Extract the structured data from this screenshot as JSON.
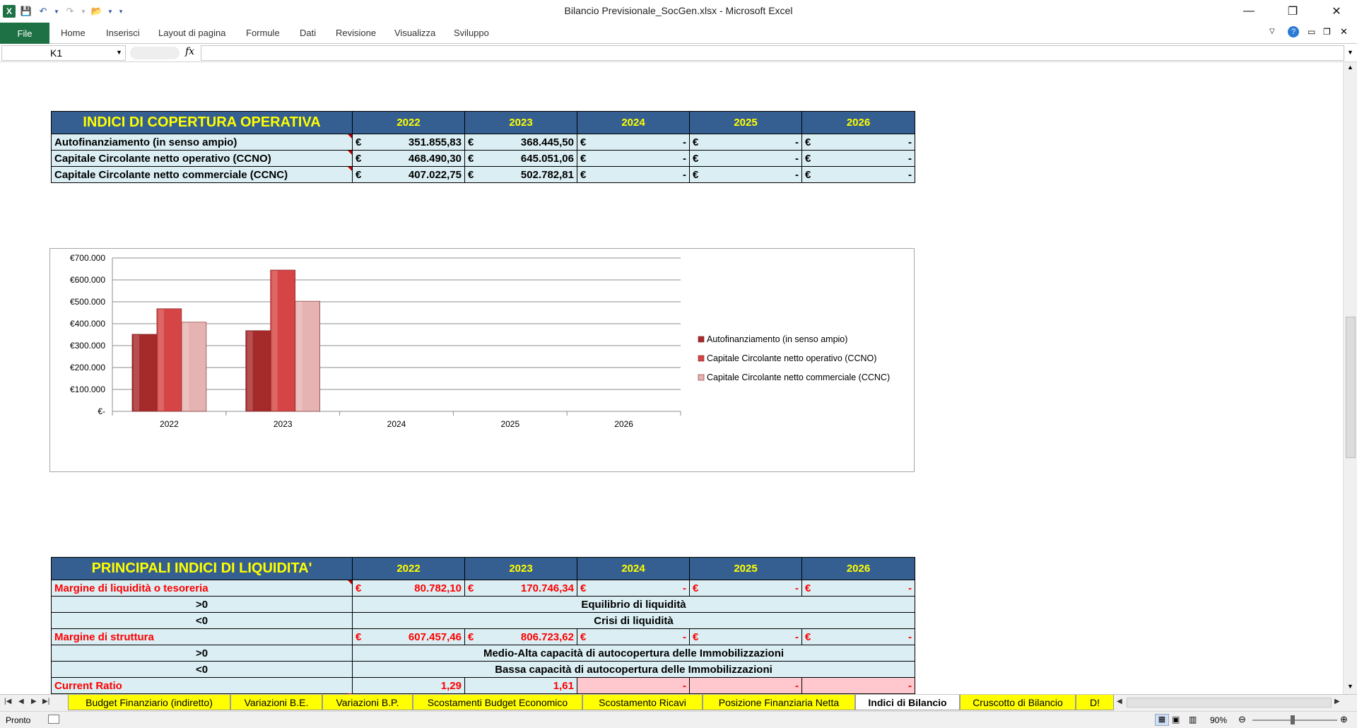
{
  "window": {
    "title": "Bilancio Previsionale_SocGen.xlsx  -  Microsoft Excel"
  },
  "ribbon": {
    "file": "File",
    "tabs": [
      "Home",
      "Inserisci",
      "Layout di pagina",
      "Formule",
      "Dati",
      "Revisione",
      "Visualizza",
      "Sviluppo"
    ]
  },
  "formula_bar": {
    "name_box": "K1",
    "fx": "fx",
    "value": ""
  },
  "table1": {
    "title": "INDICI DI COPERTURA OPERATIVA",
    "years": [
      "2022",
      "2023",
      "2024",
      "2025",
      "2026"
    ],
    "currency": "€",
    "rows": [
      {
        "label": "Autofinanziamento (in senso ampio)",
        "values": [
          "351.855,83",
          "368.445,50",
          "-",
          "-",
          "-"
        ]
      },
      {
        "label": "Capitale Circolante netto operativo (CCNO)",
        "values": [
          "468.490,30",
          "645.051,06",
          "-",
          "-",
          "-"
        ]
      },
      {
        "label": "Capitale Circolante netto commerciale (CCNC)",
        "values": [
          "407.022,75",
          "502.782,81",
          "-",
          "-",
          "-"
        ]
      }
    ]
  },
  "chart_data": {
    "type": "bar",
    "categories": [
      "2022",
      "2023",
      "2024",
      "2025",
      "2026"
    ],
    "series": [
      {
        "name": "Autofinanziamento (in senso ampio)",
        "values": [
          351855.83,
          368445.5,
          0,
          0,
          0
        ],
        "color": "#a52a2a"
      },
      {
        "name": "Capitale Circolante netto operativo (CCNO)",
        "values": [
          468490.3,
          645051.06,
          0,
          0,
          0
        ],
        "color": "#d64545"
      },
      {
        "name": "Capitale Circolante netto commerciale (CCNC)",
        "values": [
          407022.75,
          502782.81,
          0,
          0,
          0
        ],
        "color": "#e6b3b3"
      }
    ],
    "yticks": [
      "€-",
      "€100.000",
      "€200.000",
      "€300.000",
      "€400.000",
      "€500.000",
      "€600.000",
      "€700.000"
    ],
    "ylim": [
      0,
      700000
    ],
    "grid": true,
    "legend": "right",
    "title": "",
    "xlabel": "",
    "ylabel": ""
  },
  "table2": {
    "title": "PRINCIPALI INDICI DI LIQUIDITA'",
    "years": [
      "2022",
      "2023",
      "2024",
      "2025",
      "2026"
    ],
    "currency": "€",
    "margine_liquidita": {
      "label": "Margine di liquidità o tesoreria",
      "values": [
        "80.782,10",
        "170.746,34",
        "-",
        "-",
        "-"
      ]
    },
    "liq_pos": {
      "cond": ">0",
      "text": "Equilibrio di liquidità"
    },
    "liq_neg": {
      "cond": "<0",
      "text": "Crisi di liquidità"
    },
    "margine_struttura": {
      "label": "Margine di struttura",
      "values": [
        "607.457,46",
        "806.723,62",
        "-",
        "-",
        "-"
      ]
    },
    "str_pos": {
      "cond": ">0",
      "text": "Medio-Alta capacità di autocopertura delle Immobilizzazioni"
    },
    "str_neg": {
      "cond": "<0",
      "text": "Bassa capacità di autocopertura delle Immobilizzazioni"
    },
    "current_ratio": {
      "label": "Current Ratio",
      "values": [
        "1,29",
        "1,61",
        "-",
        "-",
        "-"
      ]
    }
  },
  "sheet_tabs": [
    {
      "label": "Budget Finanziario (indiretto)",
      "active": false
    },
    {
      "label": "Variazioni B.E.",
      "active": false
    },
    {
      "label": "Variazioni B.P.",
      "active": false
    },
    {
      "label": "Scostamenti Budget Economico",
      "active": false
    },
    {
      "label": "Scostamento Ricavi",
      "active": false
    },
    {
      "label": "Posizione Finanziaria Netta",
      "active": false
    },
    {
      "label": "Indici di Bilancio",
      "active": true
    },
    {
      "label": "Cruscotto di Bilancio",
      "active": false
    },
    {
      "label": "D!",
      "active": false
    }
  ],
  "status": {
    "ready": "Pronto",
    "zoom": "90%"
  }
}
